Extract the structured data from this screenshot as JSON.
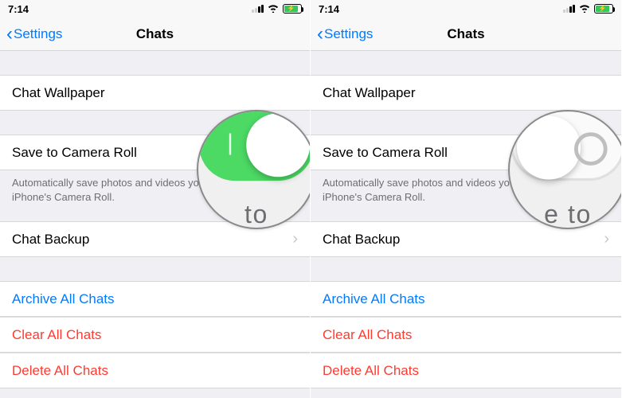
{
  "screens": [
    {
      "status": {
        "time": "7:14",
        "signal_bars_active": 2
      },
      "nav": {
        "back": "Settings",
        "title": "Chats"
      },
      "rows": {
        "wallpaper": "Chat Wallpaper",
        "save_roll": "Save to Camera Roll",
        "save_roll_on": true,
        "footer": "Automatically save photos and videos you receive to your iPhone's Camera Roll.",
        "backup": "Chat Backup"
      },
      "actions": {
        "archive": "Archive All Chats",
        "clear": "Clear All Chats",
        "delete": "Delete All Chats"
      },
      "magnifier": {
        "state": "on",
        "cut_text": "to"
      }
    },
    {
      "status": {
        "time": "7:14",
        "signal_bars_active": 2
      },
      "nav": {
        "back": "Settings",
        "title": "Chats"
      },
      "rows": {
        "wallpaper": "Chat Wallpaper",
        "save_roll": "Save to Camera Roll",
        "save_roll_on": false,
        "footer": "Automatically save photos and videos you receive to your iPhone's Camera Roll.",
        "backup": "Chat Backup"
      },
      "actions": {
        "archive": "Archive All Chats",
        "clear": "Clear All Chats",
        "delete": "Delete All Chats"
      },
      "magnifier": {
        "state": "off",
        "cut_text": "e to"
      }
    }
  ],
  "colors": {
    "ios_blue": "#007aff",
    "ios_red": "#ff3b30",
    "ios_green": "#4cd964"
  }
}
